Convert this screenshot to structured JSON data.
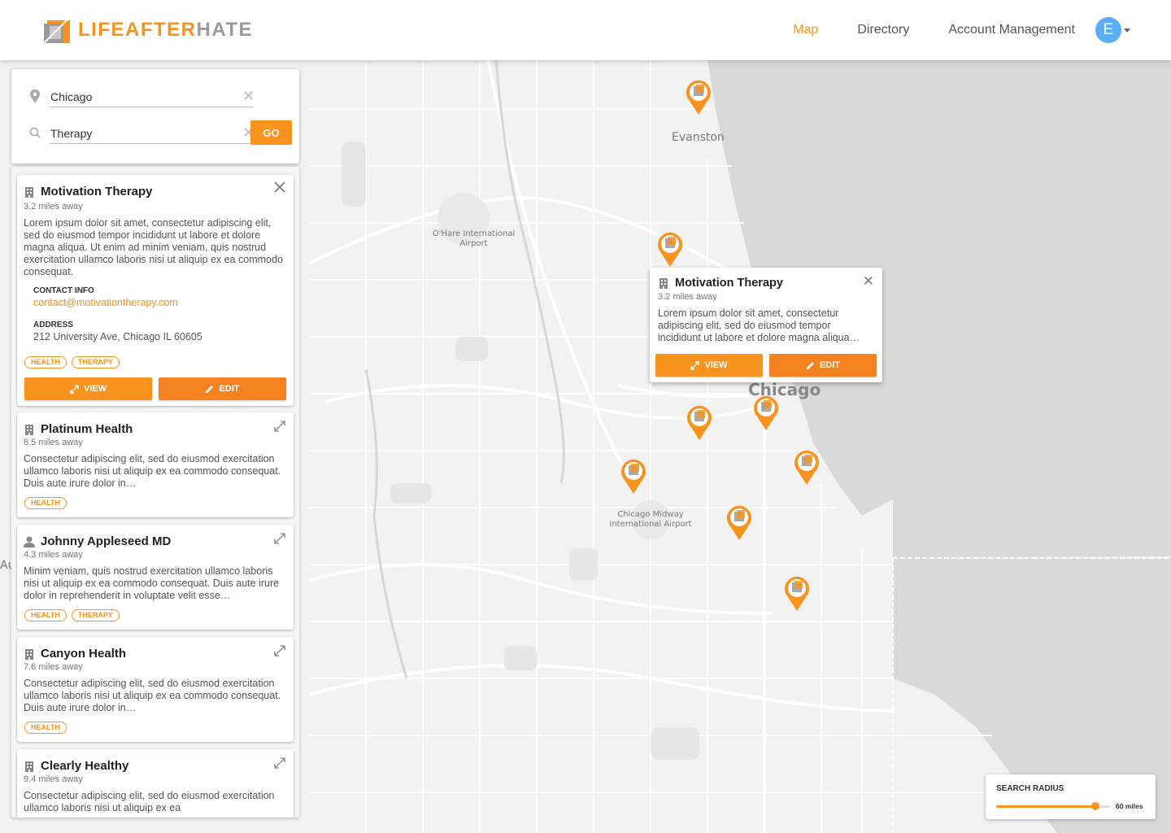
{
  "brand": {
    "part1": "LIFE",
    "part2": "AFTER",
    "part3": "HATE"
  },
  "nav": {
    "map": "Map",
    "directory": "Directory",
    "account": "Account Management",
    "avatar_initial": "E"
  },
  "search": {
    "location_value": "Chicago",
    "query_value": "Therapy",
    "go_label": "GO"
  },
  "map_labels": {
    "evanston": "Evanston",
    "ohare": "O'Hare International Airport",
    "chicago": "Chicago",
    "midway": "Chicago Midway International Airport",
    "edge": "Au"
  },
  "results": [
    {
      "title": "Motivation Therapy",
      "distance": "3.2 miles away",
      "description": "Lorem ipsum dolor sit amet, consectetur adipiscing elit, sed do eiusmod tempor incididunt ut labore et dolore magna aliqua. Ut enim ad minim veniam, quis nostrud exercitation ullamco laboris nisi ut aliquip ex ea commodo consequat.",
      "contact_heading": "CONTACT INFO",
      "contact_email": "contact@motivationtherapy.com",
      "address_heading": "ADDRESS",
      "address": "212 University Ave, Chicago IL 60605",
      "tags": [
        "HEALTH",
        "THERAPY"
      ],
      "view_label": "VIEW",
      "edit_label": "EDIT"
    },
    {
      "title": "Platinum Health",
      "distance": "8.5 miles away",
      "description": "Consectetur adipiscing elit, sed do eiusmod exercitation ullamco laboris nisi ut aliquip ex ea commodo consequat. Duis aute irure dolor in…",
      "tags": [
        "HEALTH"
      ]
    },
    {
      "title": "Johnny Appleseed MD",
      "distance": "4.3 miles away",
      "description": "Minim veniam, quis nostrud exercitation ullamco laboris nisi ut aliquip ex ea commodo consequat. Duis aute irure dolor in reprehenderit in voluptate velit esse…",
      "tags": [
        "HEALTH",
        "THERAPY"
      ]
    },
    {
      "title": "Canyon Health",
      "distance": "7.6 miles away",
      "description": "Consectetur adipiscing elit, sed do eiusmod exercitation ullamco laboris nisi ut aliquip ex ea commodo consequat. Duis aute irure dolor in…",
      "tags": [
        "HEALTH"
      ]
    },
    {
      "title": "Clearly Healthy",
      "distance": "9.4 miles away",
      "description": "Consectetur adipiscing elit, sed do eiusmod exercitation ullamco laboris nisi ut aliquip ex ea",
      "tags": []
    }
  ],
  "popup": {
    "title": "Motivation Therapy",
    "distance": "3.2 miles away",
    "description": "Lorem ipsum dolor sit amet, consectetur adipiscing elit, sed do eiusmod tempor incididunt ut labore et dolore magna aliqua…",
    "view_label": "VIEW",
    "edit_label": "EDIT"
  },
  "radius": {
    "label": "SEARCH RADIUS",
    "value": "60 miles",
    "fraction": 0.6
  },
  "colors": {
    "accent": "#f7931e",
    "avatar": "#5aaef5",
    "lake": "#d9d9d9"
  },
  "icons": [
    "location-pin-icon",
    "search-icon",
    "clear-icon",
    "building-icon",
    "person-icon",
    "close-icon",
    "expand-icon",
    "pencil-icon",
    "map-marker-icon"
  ]
}
